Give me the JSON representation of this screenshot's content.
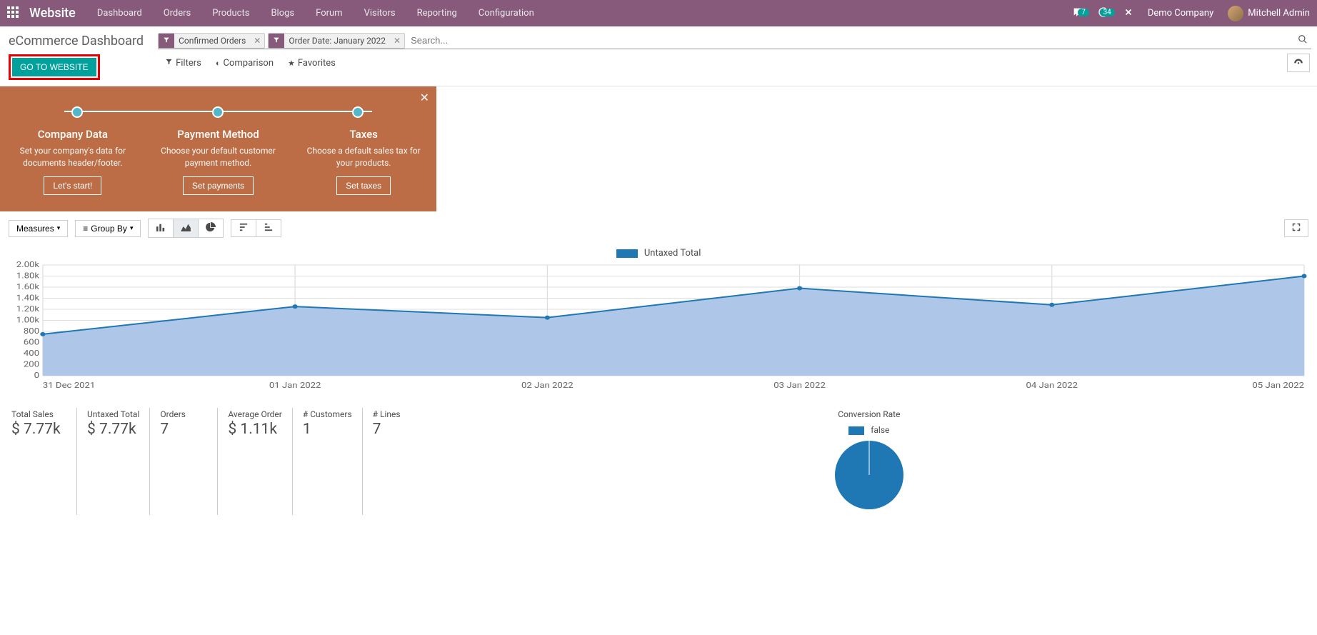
{
  "topbar": {
    "brand": "Website",
    "menu": [
      "Dashboard",
      "Orders",
      "Products",
      "Blogs",
      "Forum",
      "Visitors",
      "Reporting",
      "Configuration"
    ],
    "msg_badge": "7",
    "activity_badge": "34",
    "company": "Demo Company",
    "user": "Mitchell Admin"
  },
  "breadcrumb": "eCommerce Dashboard",
  "go_button": "GO TO WEBSITE",
  "search": {
    "facets": [
      {
        "label": "Confirmed Orders"
      },
      {
        "label": "Order Date: January 2022"
      }
    ],
    "placeholder": "Search..."
  },
  "toolbar": {
    "filters": "Filters",
    "comparison": "Comparison",
    "favorites": "Favorites"
  },
  "onboarding": {
    "steps": [
      {
        "title": "Company Data",
        "desc": "Set your company's data for documents header/footer.",
        "btn": "Let's start!"
      },
      {
        "title": "Payment Method",
        "desc": "Choose your default customer payment method.",
        "btn": "Set payments"
      },
      {
        "title": "Taxes",
        "desc": "Choose a default sales tax for your products.",
        "btn": "Set taxes"
      }
    ]
  },
  "chart_controls": {
    "measures": "Measures",
    "groupby": "Group By"
  },
  "chart_data": {
    "type": "area",
    "title": "",
    "legend": "Untaxed Total",
    "x": [
      "31 Dec 2021",
      "01 Jan 2022",
      "02 Jan 2022",
      "03 Jan 2022",
      "04 Jan 2022",
      "05 Jan 2022"
    ],
    "values": [
      750,
      1250,
      1050,
      1580,
      1280,
      1800
    ],
    "ylim": [
      0,
      2000
    ],
    "yticks": [
      "0",
      "200",
      "400",
      "600",
      "800",
      "1.00k",
      "1.20k",
      "1.40k",
      "1.60k",
      "1.80k",
      "2.00k"
    ]
  },
  "kpis": [
    {
      "label": "Total Sales",
      "value": "$ 7.77k"
    },
    {
      "label": "Untaxed Total",
      "value": "$ 7.77k"
    },
    {
      "label": "Orders",
      "value": "7"
    },
    {
      "label": "Average Order",
      "value": "$ 1.11k"
    },
    {
      "label": "# Customers",
      "value": "1"
    },
    {
      "label": "# Lines",
      "value": "7"
    }
  ],
  "conversion": {
    "label": "Conversion Rate",
    "legend": "false",
    "slices": [
      {
        "name": "false",
        "value": 100
      }
    ]
  }
}
